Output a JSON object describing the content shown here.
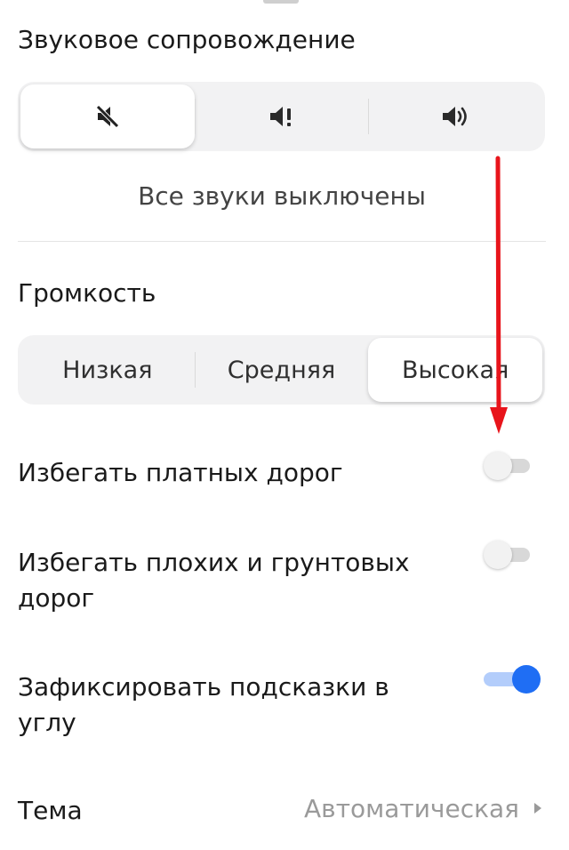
{
  "sound": {
    "title": "Звуковое сопровождение",
    "options": [
      {
        "icon": "speaker-muted-icon",
        "selected": true
      },
      {
        "icon": "speaker-alert-icon",
        "selected": false
      },
      {
        "icon": "speaker-on-icon",
        "selected": false
      }
    ],
    "status": "Все звуки выключены"
  },
  "volume": {
    "title": "Громкость",
    "options": [
      "Низкая",
      "Средняя",
      "Высокая"
    ],
    "selected": "Высокая"
  },
  "settings": [
    {
      "label": "Избегать платных дорог",
      "enabled": false
    },
    {
      "label": "Избегать плохих и грунтовых дорог",
      "enabled": false
    },
    {
      "label": "Зафиксировать подсказки в углу",
      "enabled": true
    }
  ],
  "theme": {
    "label": "Тема",
    "value": "Автоматическая"
  },
  "colors": {
    "accent": "#1f6ef4",
    "annotation": "#e8141b"
  }
}
